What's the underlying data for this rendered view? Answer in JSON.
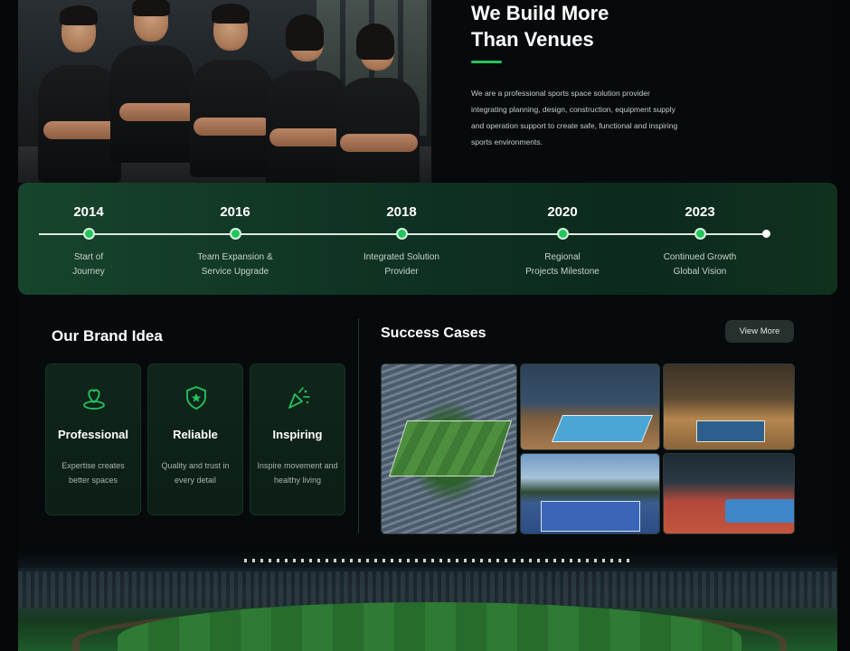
{
  "intro": {
    "title_line1": "We Build More",
    "title_line2": "Than Venues",
    "description": "We are a professional sports space solution provider integrating planning, design, construction, equipment supply and operation support to create safe, functional and inspiring sports environments."
  },
  "timeline": {
    "milestones": [
      {
        "year": "2014",
        "label": "Start of\nJourney"
      },
      {
        "year": "2016",
        "label": "Team Expansion &\nService Upgrade"
      },
      {
        "year": "2018",
        "label": "Integrated Solution\nProvider"
      },
      {
        "year": "2020",
        "label": "Regional\nProjects Milestone"
      },
      {
        "year": "2023",
        "label": "Continued Growth\nGlobal Vision"
      }
    ]
  },
  "brand": {
    "title": "Our Brand Idea",
    "cards": [
      {
        "icon": "location-heart-icon",
        "name": "Professional",
        "desc": "Expertise creates better spaces"
      },
      {
        "icon": "shield-star-icon",
        "name": "Reliable",
        "desc": "Quality and trust in every detail"
      },
      {
        "icon": "party-popper-icon",
        "name": "Inspiring",
        "desc": "Inspire movement and healthy living"
      }
    ]
  },
  "cases": {
    "title": "Success Cases",
    "view_more": "View More"
  },
  "colors": {
    "accent": "#22c55e",
    "background": "#070a0c",
    "timeline_bg": "#0f3222",
    "card_bg": "#10261b"
  }
}
